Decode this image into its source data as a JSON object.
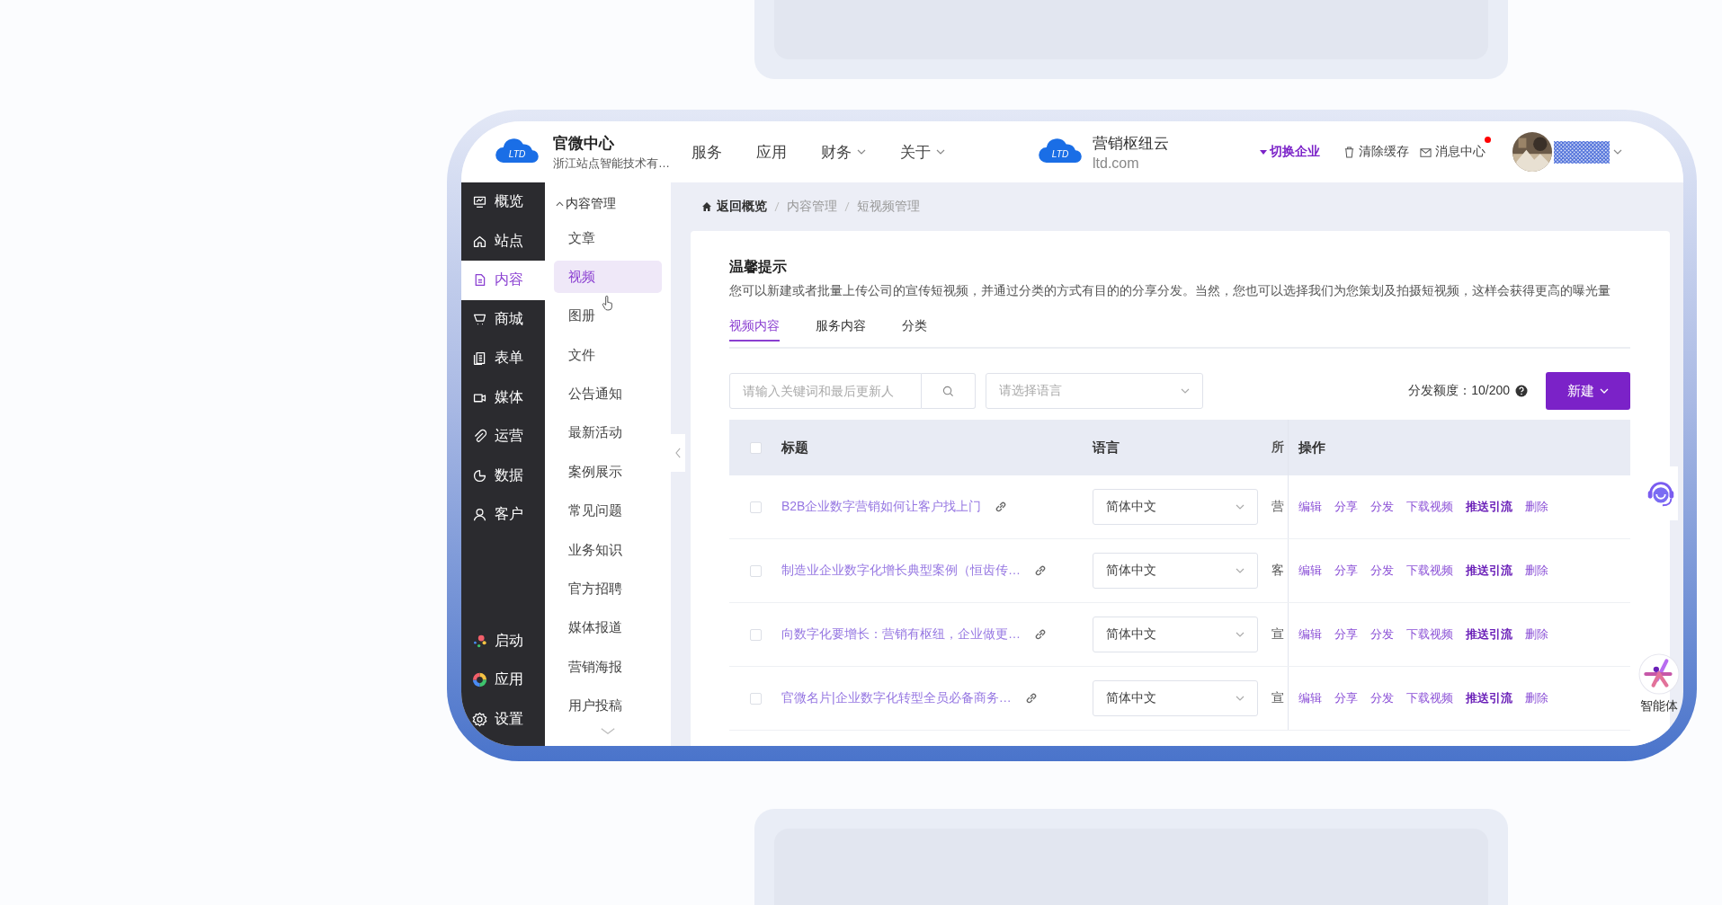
{
  "header": {
    "logo_text": "LTD",
    "brand": {
      "title": "官微中心",
      "subtitle": "浙江站点智能技术有…"
    },
    "nav": [
      {
        "label": "服务",
        "kind": "plain"
      },
      {
        "label": "应用",
        "kind": "plain"
      },
      {
        "label": "财务",
        "kind": "dropdown"
      },
      {
        "label": "关于",
        "kind": "dropdown"
      }
    ],
    "product": {
      "logo_text": "LTD",
      "title": "营销枢纽云",
      "subtitle": "ltd.com"
    },
    "switch": "切换企业",
    "clear_cache": "清除缓存",
    "messages": {
      "label": "消息中心",
      "unread": true
    }
  },
  "sidebar": {
    "items": [
      {
        "label": "概览",
        "selected": false
      },
      {
        "label": "站点",
        "selected": false
      },
      {
        "label": "内容",
        "selected": true
      },
      {
        "label": "商城",
        "selected": false
      },
      {
        "label": "表单",
        "selected": false
      },
      {
        "label": "媒体",
        "selected": false
      },
      {
        "label": "运营",
        "selected": false
      },
      {
        "label": "数据",
        "selected": false
      },
      {
        "label": "客户",
        "selected": false
      }
    ],
    "bottom": [
      {
        "label": "启动"
      },
      {
        "label": "应用"
      },
      {
        "label": "设置"
      }
    ]
  },
  "submenu": {
    "group": "内容管理",
    "expanded": true,
    "items": [
      {
        "label": "文章",
        "selected": false
      },
      {
        "label": "视频",
        "selected": true
      },
      {
        "label": "图册",
        "selected": false
      },
      {
        "label": "文件",
        "selected": false
      },
      {
        "label": "公告通知",
        "selected": false
      },
      {
        "label": "最新活动",
        "selected": false
      },
      {
        "label": "案例展示",
        "selected": false
      },
      {
        "label": "常见问题",
        "selected": false
      },
      {
        "label": "业务知识",
        "selected": false
      },
      {
        "label": "官方招聘",
        "selected": false
      },
      {
        "label": "媒体报道",
        "selected": false
      },
      {
        "label": "营销海报",
        "selected": false
      },
      {
        "label": "用户投稿",
        "selected": false
      }
    ]
  },
  "breadcrumb": [
    "返回概览",
    "内容管理",
    "短视频管理"
  ],
  "notice": {
    "title": "温馨提示",
    "text": "您可以新建或者批量上传公司的宣传短视频，并通过分类的方式有目的的分享分发。当然，您也可以选择我们为您策划及拍摄短视频，这样会获得更高的曝光量"
  },
  "tabs": [
    {
      "label": "视频内容",
      "selected": true
    },
    {
      "label": "服务内容",
      "selected": false
    },
    {
      "label": "分类",
      "selected": false
    }
  ],
  "search": {
    "placeholder": "请输入关键词和最后更新人"
  },
  "language_select": {
    "placeholder": "请选择语言"
  },
  "quota": {
    "label": "分发额度：",
    "value": "10/200"
  },
  "new_button": "新建",
  "table": {
    "columns": [
      {
        "label": "标题"
      },
      {
        "label": "语言"
      },
      {
        "label": "所"
      },
      {
        "label": "操作"
      }
    ],
    "header_checked": false,
    "rows": [
      {
        "checked": false,
        "title": "B2B企业数字营销如何让客户找上门",
        "language": "简体中文",
        "column_3": "营",
        "actions": [
          {
            "label": "编辑",
            "kind": "normal"
          },
          {
            "label": "分享",
            "kind": "normal"
          },
          {
            "label": "分发",
            "kind": "normal"
          },
          {
            "label": "下载视频",
            "kind": "normal"
          },
          {
            "label": "推送引流",
            "kind": "strong"
          },
          {
            "label": "删除",
            "kind": "normal"
          }
        ]
      },
      {
        "checked": false,
        "title": "制造业企业数字化增长典型案例（恒齿传…",
        "language": "简体中文",
        "column_3": "客",
        "actions": [
          {
            "label": "编辑",
            "kind": "normal"
          },
          {
            "label": "分享",
            "kind": "normal"
          },
          {
            "label": "分发",
            "kind": "normal"
          },
          {
            "label": "下载视频",
            "kind": "normal"
          },
          {
            "label": "推送引流",
            "kind": "strong"
          },
          {
            "label": "删除",
            "kind": "normal"
          }
        ]
      },
      {
        "checked": false,
        "title": "向数字化要增长：营销有枢纽，企业做更…",
        "language": "简体中文",
        "column_3": "宣",
        "actions": [
          {
            "label": "编辑",
            "kind": "normal"
          },
          {
            "label": "分享",
            "kind": "normal"
          },
          {
            "label": "分发",
            "kind": "normal"
          },
          {
            "label": "下载视频",
            "kind": "normal"
          },
          {
            "label": "推送引流",
            "kind": "strong"
          },
          {
            "label": "删除",
            "kind": "normal"
          }
        ]
      },
      {
        "checked": false,
        "title": "官微名片|企业数字化转型全员必备商务…",
        "language": "简体中文",
        "column_3": "宣",
        "actions": [
          {
            "label": "编辑",
            "kind": "normal"
          },
          {
            "label": "分享",
            "kind": "normal"
          },
          {
            "label": "分发",
            "kind": "normal"
          },
          {
            "label": "下载视频",
            "kind": "normal"
          },
          {
            "label": "推送引流",
            "kind": "strong"
          },
          {
            "label": "删除",
            "kind": "normal"
          }
        ]
      }
    ]
  },
  "assistant": {
    "label": "智能体"
  }
}
